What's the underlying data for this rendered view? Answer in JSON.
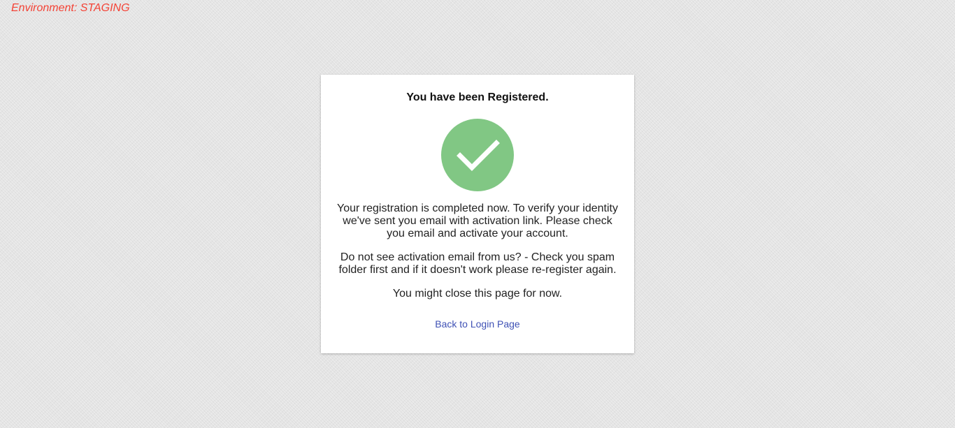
{
  "environment": {
    "label": "Environment: STAGING",
    "color": "#f44336"
  },
  "card": {
    "title": "You have been Registered.",
    "status_icon": "checkmark-circle-icon",
    "status_color": "#81c784",
    "messages": [
      "Your registration is completed now. To verify your identity we've sent you email with activation link. Please check you email and activate your account.",
      "Do not see activation email from us? - Check you spam folder first and if it doesn't work please re-register again.",
      "You might close this page for now."
    ],
    "back_link_label": "Back to Login Page",
    "link_color": "#3f51b5"
  }
}
